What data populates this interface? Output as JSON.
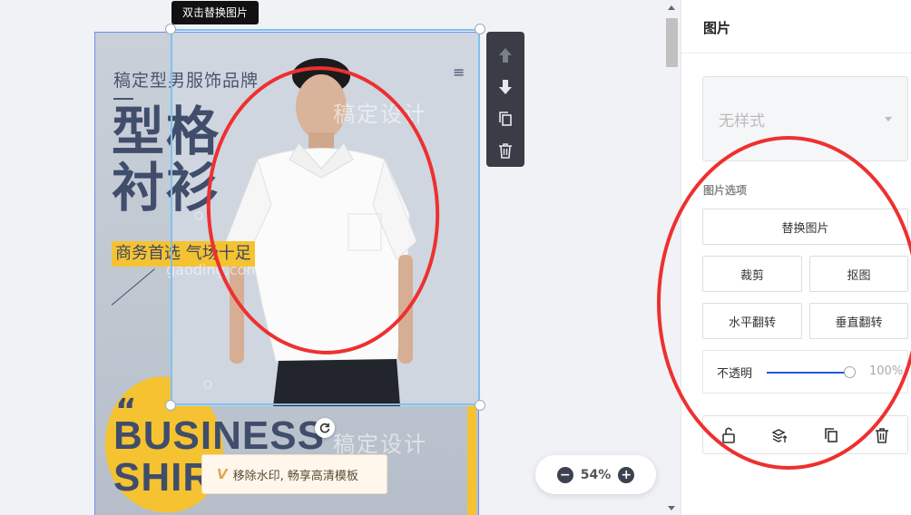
{
  "tooltip": "双击替换图片",
  "poster": {
    "brand": "稿定型男服饰品牌",
    "title_line1": "型格",
    "title_line2": "衬衫",
    "slogan": "商务首选 气场十足",
    "quote_mark": "“",
    "business_line1": "BUSINESS",
    "business_line2": "SHIR",
    "watermark_text": "稿定设计",
    "watermark_domain": "gaoding.com"
  },
  "watermark_banner": {
    "label": "移除水印, 畅享高清模板",
    "badge": "VIP"
  },
  "zoom": {
    "level": "54%",
    "minus": "−",
    "plus": "+"
  },
  "panel": {
    "title": "图片",
    "style_value": "无样式",
    "section_label": "图片选项",
    "replace": "替换图片",
    "crop": "裁剪",
    "cutout": "抠图",
    "flip_h": "水平翻转",
    "flip_v": "垂直翻转",
    "opacity_label": "不透明",
    "opacity_value": "100%"
  },
  "opacity_level": 1.0,
  "colors": {
    "annotation": "#ee3030",
    "accent": "#1f5bd8",
    "poster_yellow": "#f5c331",
    "poster_ink": "#404d6b"
  }
}
